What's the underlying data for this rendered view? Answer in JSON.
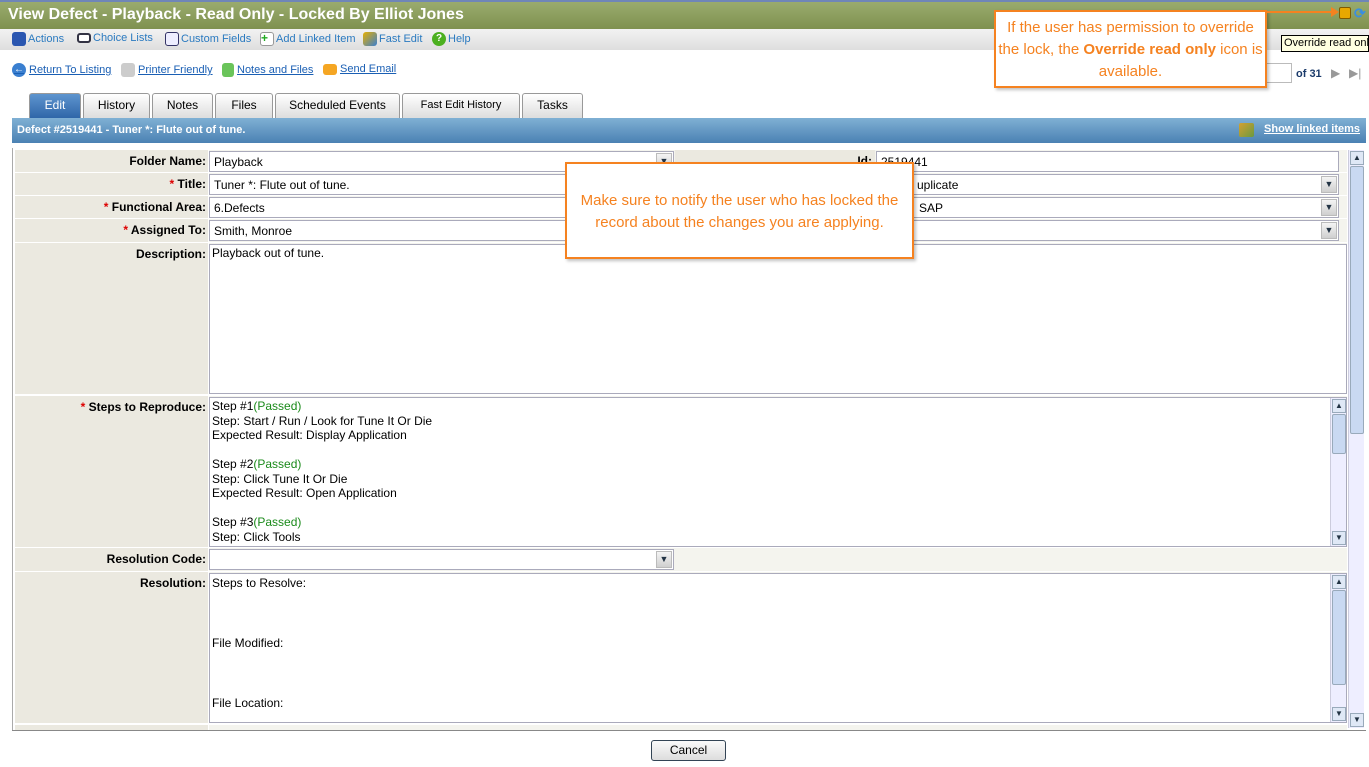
{
  "window": {
    "title": "View Defect - Playback - Read Only - Locked By Elliot Jones"
  },
  "toolbar": {
    "items": [
      {
        "label": "Actions",
        "icon": "actions-icon"
      },
      {
        "label": "Choice Lists",
        "icon": "choice-lists-icon"
      },
      {
        "label": "Custom Fields",
        "icon": "custom-fields-icon"
      },
      {
        "label": "Add Linked Item",
        "icon": "add-linked-item-icon"
      },
      {
        "label": "Fast Edit",
        "icon": "fast-edit-icon"
      },
      {
        "label": "Help",
        "icon": "help-icon"
      }
    ]
  },
  "links": [
    {
      "label": "Return To Listing",
      "icon": "back-arrow-icon"
    },
    {
      "label": "Printer Friendly",
      "icon": "printer-icon"
    },
    {
      "label": "Notes and Files",
      "icon": "note-icon"
    },
    {
      "label": "Send Email",
      "icon": "email-icon"
    }
  ],
  "pager": {
    "current": "",
    "total_label": "of 31"
  },
  "tooltip": "Override read onl",
  "tabs": [
    {
      "label": "Edit",
      "active": true
    },
    {
      "label": "History"
    },
    {
      "label": "Notes"
    },
    {
      "label": "Files"
    },
    {
      "label": "Scheduled Events"
    },
    {
      "label": "Fast Edit History"
    },
    {
      "label": "Tasks"
    }
  ],
  "record": {
    "header": "Defect #2519441 - Tuner *: Flute out of tune.",
    "show_linked": "Show linked items"
  },
  "form": {
    "folder_name": {
      "label": "Folder Name:",
      "value": "Playback"
    },
    "id": {
      "label": "Id:",
      "value": "2519441"
    },
    "title": {
      "label": "Title:",
      "value": "Tuner *: Flute out of tune."
    },
    "status": {
      "value": "uplicate"
    },
    "functional_area": {
      "label": "Functional Area:",
      "value": "6.Defects"
    },
    "product": {
      "value": "SAP"
    },
    "assigned_to": {
      "label": "Assigned To:",
      "value": "Smith, Monroe"
    },
    "assigned_right": {
      "value": ""
    },
    "description": {
      "label": "Description:",
      "value": "Playback out of tune."
    },
    "steps": {
      "label": "Steps to Reproduce:",
      "items": [
        {
          "step": "Step #1",
          "status": "(Passed)",
          "action": "Step: Start / Run / Look for Tune It Or Die",
          "expected": "Expected Result: Display Application"
        },
        {
          "step": "Step #2",
          "status": "(Passed)",
          "action": "Step: Click Tune It Or Die",
          "expected": "Expected Result: Open Application"
        },
        {
          "step": "Step #3",
          "status": "(Passed)",
          "action": "Step: Click Tools",
          "expected": ""
        }
      ]
    },
    "resolution_code": {
      "label": "Resolution Code:",
      "value": ""
    },
    "resolution": {
      "label": "Resolution:",
      "lines": [
        "Steps to Resolve:",
        "File Modified:",
        "File Location:"
      ]
    }
  },
  "footer": {
    "cancel": "Cancel"
  },
  "callouts": {
    "lock": {
      "pre": "If the user has permission to override the lock, the ",
      "bold": "Override read only",
      "post": " icon is available."
    },
    "notify": "Make sure to notify the user who has locked the record about the changes you are applying."
  },
  "colors": {
    "accent": "#f58220",
    "titlebar": "#8a9b5c",
    "header": "#4b81b3"
  }
}
